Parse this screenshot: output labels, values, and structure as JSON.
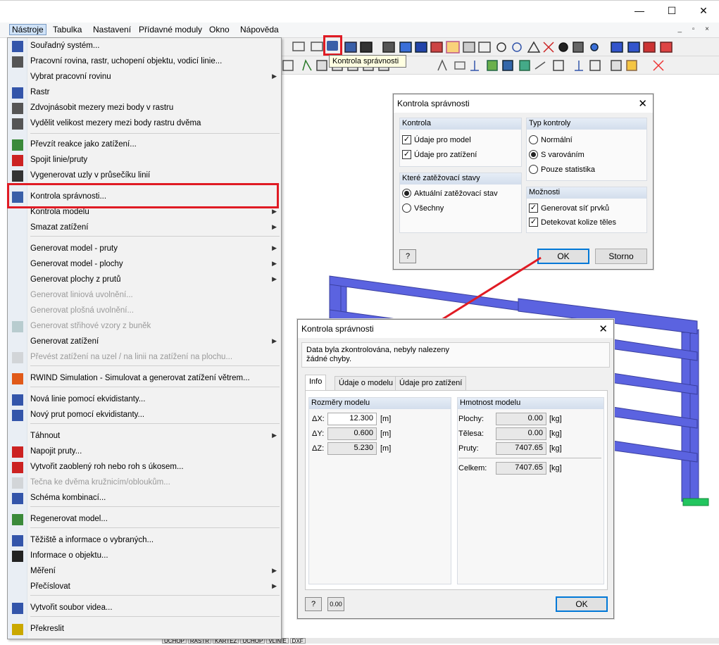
{
  "menubar": {
    "items": [
      "Nástroje",
      "Tabulka",
      "Nastavení",
      "Přídavné moduly",
      "Okno",
      "Nápověda"
    ]
  },
  "window": {
    "minimize": "—",
    "maximize": "☐",
    "close": "✕"
  },
  "tooltip": "Kontrola správnosti",
  "menu": {
    "items": [
      {
        "label": "Souřadný systém...",
        "icon": "coordinate-system-icon"
      },
      {
        "label": "Pracovní rovina, rastr, uchopení objektu, vodicí linie...",
        "icon": "work-plane-icon"
      },
      {
        "label": "Vybrat pracovní rovinu",
        "submenu": true
      },
      {
        "label": "Rastr",
        "icon": "grid-icon"
      },
      {
        "label": "Zdvojnásobit mezery mezi body v rastru",
        "icon": "grid-double-icon"
      },
      {
        "label": "Vydělit velikost mezery mezi body rastru dvěma",
        "icon": "grid-half-icon"
      },
      {
        "label": "Převzít reakce jako zatížení...",
        "icon": "reactions-icon"
      },
      {
        "label": "Spojit linie/pruty",
        "icon": "connect-lines-icon"
      },
      {
        "label": "Vygenerovat uzly v průsečíku linií",
        "icon": "intersection-icon"
      },
      {
        "label": "Kontrola správnosti...",
        "icon": "plausibility-check-icon"
      },
      {
        "label": "Kontrola modelu",
        "submenu": true
      },
      {
        "label": "Smazat zatížení",
        "submenu": true
      },
      {
        "label": "Generovat model - pruty",
        "submenu": true
      },
      {
        "label": "Generovat model - plochy",
        "submenu": true
      },
      {
        "label": "Generovat plochy z prutů",
        "submenu": true
      },
      {
        "label": "Generovat liniová uvolnění...",
        "disabled": true
      },
      {
        "label": "Generovat plošná uvolnění...",
        "disabled": true
      },
      {
        "label": "Generovat střihové vzory z buněk",
        "disabled": true,
        "icon": "pattern-icon"
      },
      {
        "label": "Generovat zatížení",
        "submenu": true
      },
      {
        "label": "Převést zatížení na uzel / na linii na zatížení na plochu...",
        "disabled": true,
        "icon": "convert-load-icon"
      },
      {
        "label": "RWIND Simulation - Simulovat a generovat zatížení větrem...",
        "icon": "rwind-icon"
      },
      {
        "label": "Nová linie pomocí ekvidistanty...",
        "icon": "offset-line-icon"
      },
      {
        "label": "Nový prut pomocí ekvidistanty...",
        "icon": "offset-member-icon"
      },
      {
        "label": "Táhnout",
        "submenu": true
      },
      {
        "label": "Napojit pruty...",
        "icon": "connect-members-icon"
      },
      {
        "label": "Vytvořit zaoblený roh nebo roh s úkosem...",
        "icon": "fillet-icon"
      },
      {
        "label": "Tečna ke dvěma kružnicím/obloukům...",
        "disabled": true,
        "icon": "tangent-icon"
      },
      {
        "label": "Schéma kombinací...",
        "icon": "combination-scheme-icon"
      },
      {
        "label": "Regenerovat model...",
        "icon": "regenerate-icon"
      },
      {
        "label": "Těžiště a informace o vybraných...",
        "icon": "centroid-icon"
      },
      {
        "label": "Informace o objektu...",
        "icon": "info-icon"
      },
      {
        "label": "Měření",
        "submenu": true
      },
      {
        "label": "Přečíslovat",
        "submenu": true
      },
      {
        "label": "Vytvořit soubor videa...",
        "icon": "video-icon"
      },
      {
        "label": "Překreslit",
        "icon": "redraw-icon"
      }
    ]
  },
  "check_dialog": {
    "title": "Kontrola správnosti",
    "group_kontrola": "Kontrola",
    "chk_model": "Údaje pro model",
    "chk_load": "Údaje pro zatížení",
    "group_typ": "Typ kontroly",
    "rad_normal": "Normální",
    "rad_warn": "S varováním",
    "rad_stats": "Pouze statistika",
    "group_stavy": "Které zatěžovací stavy",
    "rad_current": "Aktuální zatěžovací stav",
    "rad_all": "Všechny",
    "group_moznosti": "Možnosti",
    "chk_mesh": "Generovat síť prvků",
    "chk_collision": "Detekovat kolize těles",
    "ok": "OK",
    "cancel": "Storno"
  },
  "result_dialog": {
    "title": "Kontrola správnosti",
    "message_l1": "Data byla zkontrolována, nebyly nalezeny",
    "message_l2": "žádné chyby.",
    "tabs": [
      "Info",
      "Údaje o modelu",
      "Údaje pro zatížení"
    ],
    "group_rozmery": "Rozměry modelu",
    "dx_label": "ΔX:",
    "dx": "12.300",
    "dx_unit": "[m]",
    "dy_label": "ΔY:",
    "dy": "0.600",
    "dy_unit": "[m]",
    "dz_label": "ΔZ:",
    "dz": "5.230",
    "dz_unit": "[m]",
    "group_hmotnost": "Hmotnost modelu",
    "plochy_label": "Plochy:",
    "plochy": "0.00",
    "plochy_unit": "[kg]",
    "telesa_label": "Tělesa:",
    "telesa": "0.00",
    "telesa_unit": "[kg]",
    "pruty_label": "Pruty:",
    "pruty": "7407.65",
    "pruty_unit": "[kg]",
    "celkem_label": "Celkem:",
    "celkem": "7407.65",
    "celkem_unit": "[kg]",
    "ok": "OK"
  },
  "status_bar": [
    "UCHOP",
    "RASTR",
    "KARTEZ",
    "UCHOP",
    "VLINIE",
    "DXF"
  ],
  "colors": {
    "highlight": "#e01b24",
    "model_blue": "#5b63e0",
    "support_green": "#22c55e"
  }
}
